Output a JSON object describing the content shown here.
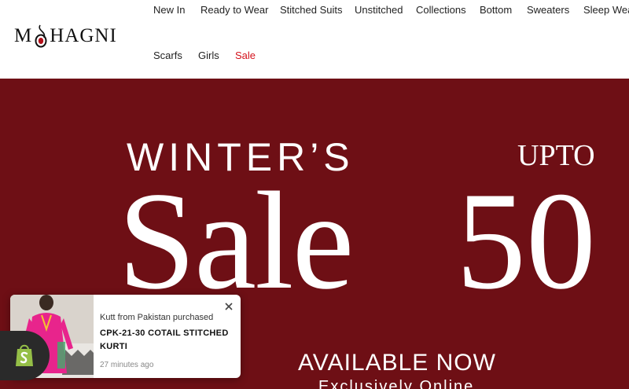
{
  "brand": {
    "logo_text_left": "M",
    "logo_text_right": "HAGNI"
  },
  "nav": {
    "items": [
      {
        "label": "New In",
        "id": "new-in"
      },
      {
        "label": "Ready to Wear",
        "id": "ready-to-wear"
      },
      {
        "label": "Stitched Suits",
        "id": "stitched-suits"
      },
      {
        "label": "Unstitched",
        "id": "unstitched"
      },
      {
        "label": "Collections",
        "id": "collections"
      },
      {
        "label": "Bottom",
        "id": "bottom"
      },
      {
        "label": "Sweaters",
        "id": "sweaters"
      },
      {
        "label": "Sleep Wear",
        "id": "sleep-wear"
      },
      {
        "label": "Scarfs",
        "id": "scarfs"
      },
      {
        "label": "Girls",
        "id": "girls"
      },
      {
        "label": "Sale",
        "id": "sale"
      }
    ],
    "sale_color": "#d4111b"
  },
  "hero": {
    "background_color": "#6e0f15",
    "headline": "WINTER’S",
    "upto": "UPTO",
    "sale_word": "Sale",
    "percent": "50",
    "available": "AVAILABLE NOW",
    "exclusive": "Exclusively Online"
  },
  "popup": {
    "purchased_text": "Kutt from Pakistan purchased",
    "product_name": "CPK-21-30 COTAIL STITCHED KURTI",
    "time_ago": "27 minutes ago",
    "close_icon": "close-icon",
    "image_icon": "product-thumbnail"
  },
  "shopify": {
    "icon": "shopify-bag-icon",
    "color": "#95bf47"
  }
}
